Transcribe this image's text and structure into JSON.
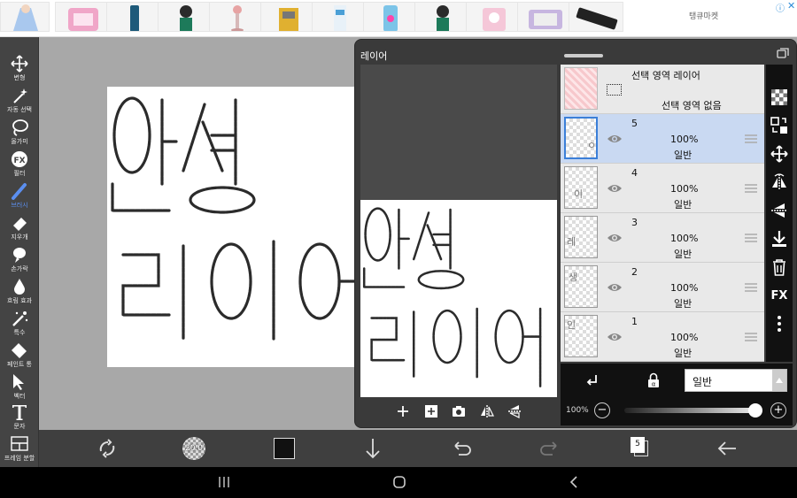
{
  "ad_banner": {
    "brand": "탱큐마켓",
    "info_icon": "info-icon",
    "close_icon": "close-icon",
    "product_count": 11
  },
  "left_toolbar": {
    "tools": [
      {
        "icon": "move-icon",
        "label": "변형"
      },
      {
        "icon": "magic-wand-icon",
        "label": "자동 선택"
      },
      {
        "icon": "lasso-icon",
        "label": "올가미"
      },
      {
        "icon": "fx-icon",
        "label": "필터"
      },
      {
        "icon": "brush-icon",
        "label": "브러시",
        "selected": true
      },
      {
        "icon": "eraser-icon",
        "label": "지우개"
      },
      {
        "icon": "finger-icon",
        "label": "손가락"
      },
      {
        "icon": "blur-drop-icon",
        "label": "흐림 효과"
      },
      {
        "icon": "special-wand-icon",
        "label": "특수"
      },
      {
        "icon": "paint-bucket-icon",
        "label": "페인트 통"
      },
      {
        "icon": "vector-cursor-icon",
        "label": "벡터"
      },
      {
        "icon": "text-icon",
        "label": "문자"
      },
      {
        "icon": "frame-divide-icon",
        "label": "프레임 분할"
      }
    ]
  },
  "canvas": {
    "drawing_text_line1": "인생",
    "drawing_text_line2": "레이어"
  },
  "bottom_toolbar": {
    "brush_size": "20.0",
    "layer_count": "5"
  },
  "layer_panel": {
    "title": "레이어",
    "selection_layer": {
      "title": "선택 영역 레이어",
      "subtitle": "선택 영역 없음"
    },
    "layers": [
      {
        "number": "5",
        "opacity": "100%",
        "blend": "일반",
        "selected": true,
        "thumb": "ㅇ"
      },
      {
        "number": "4",
        "opacity": "100%",
        "blend": "일반",
        "selected": false,
        "thumb": "이"
      },
      {
        "number": "3",
        "opacity": "100%",
        "blend": "일반",
        "selected": false,
        "thumb": "레"
      },
      {
        "number": "2",
        "opacity": "100%",
        "blend": "일반",
        "selected": false,
        "thumb": "생"
      },
      {
        "number": "1",
        "opacity": "100%",
        "blend": "일반",
        "selected": false,
        "thumb": "인"
      }
    ],
    "right_tools": [
      "checker-icon",
      "transfer-icon",
      "move-layer-icon",
      "flip-h-icon",
      "flip-v-icon",
      "merge-down-icon",
      "trash-icon",
      "fx-text-icon",
      "more-icon"
    ],
    "fx_label": "FX",
    "blend_mode": "일반",
    "opacity_label": "100%",
    "opacity_value": 1.0,
    "minus": "−",
    "plus": "+"
  },
  "colors": {
    "accent": "#3b7fd8",
    "selected_row": "#c9d9f2",
    "toolbar": "#444444",
    "panel": "#3a3a3a"
  }
}
